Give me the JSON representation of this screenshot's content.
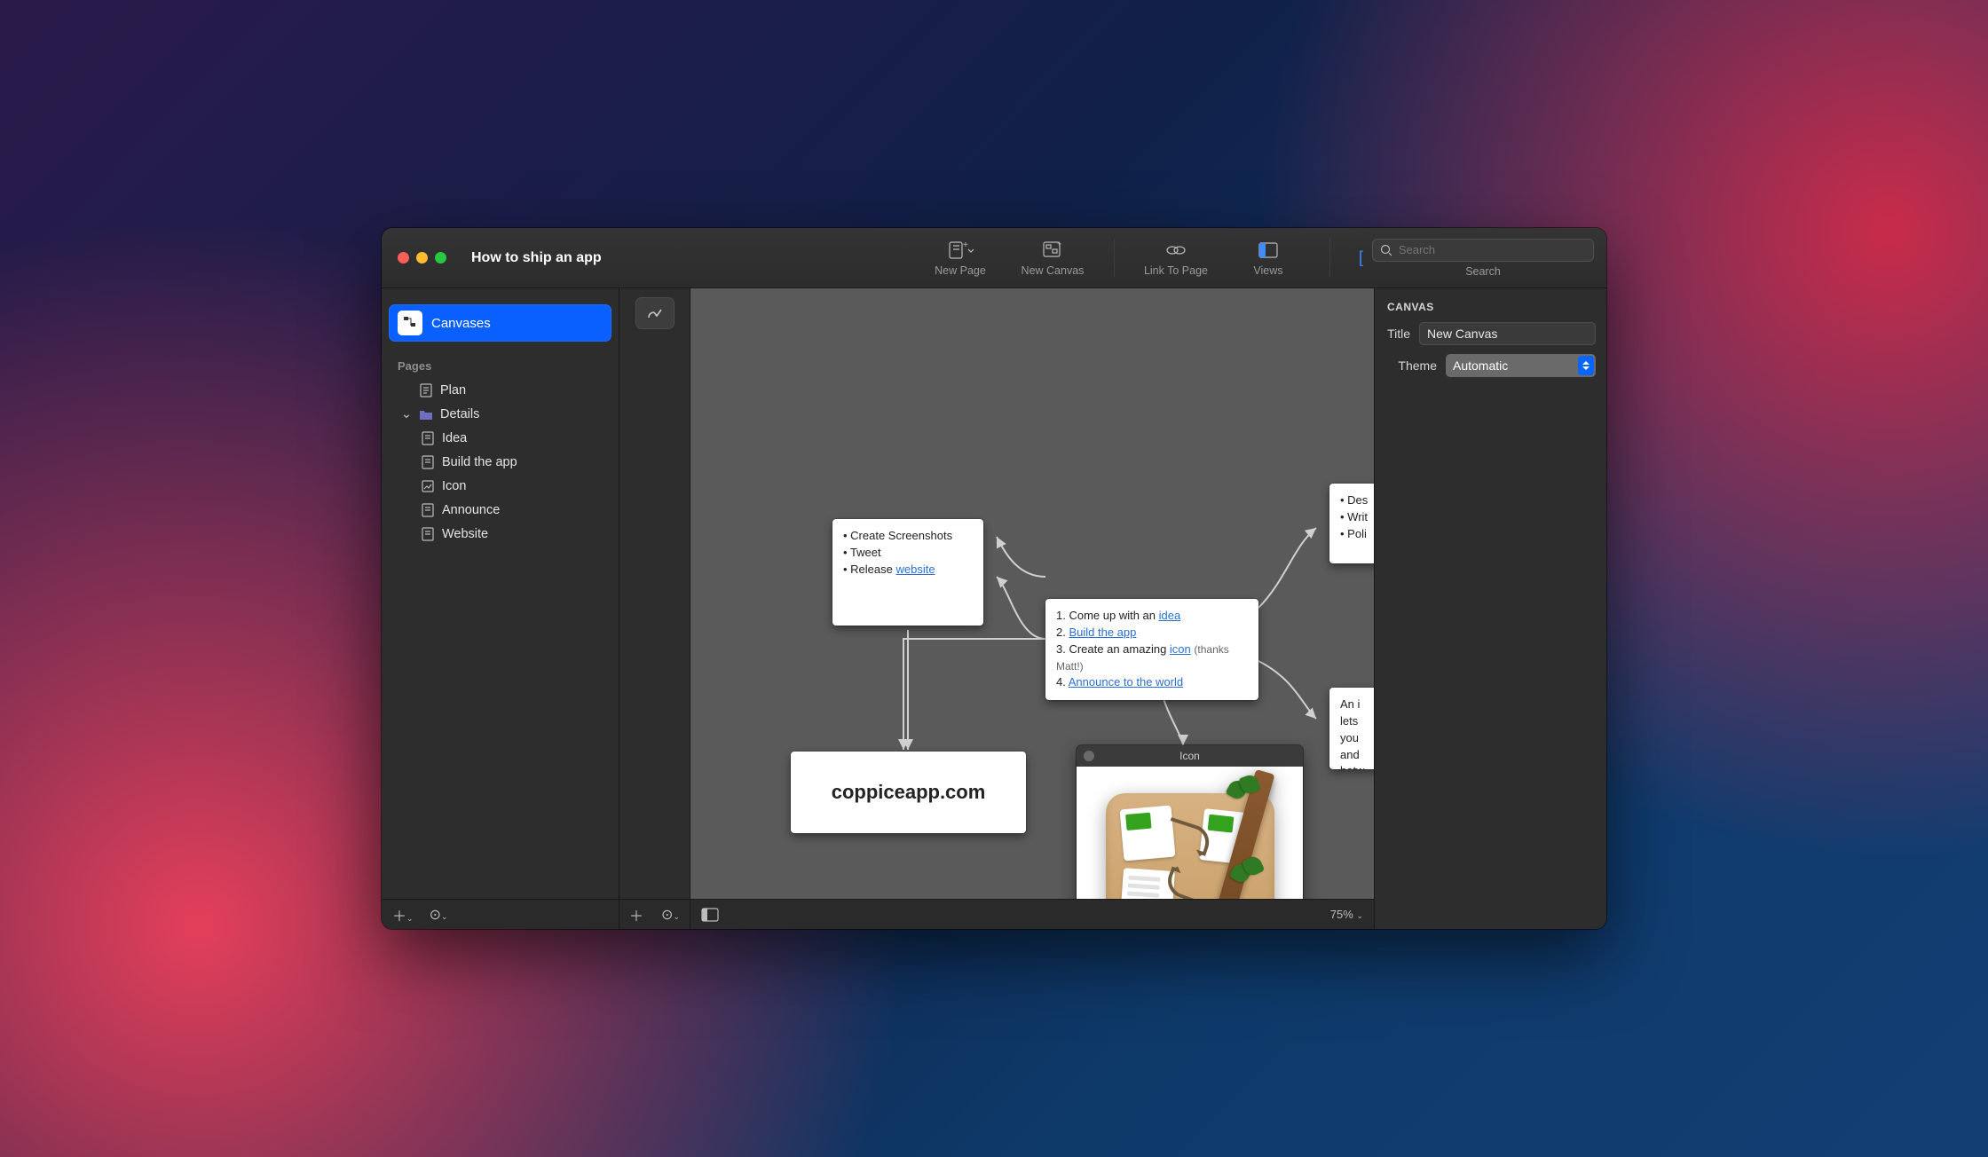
{
  "window_title": "How to ship an app",
  "toolbar": {
    "new_page": "New Page",
    "new_canvas": "New Canvas",
    "link_to_page": "Link To Page",
    "views": "Views",
    "search_label": "Search",
    "search_placeholder": "Search"
  },
  "sidebar": {
    "tab_label": "Canvases",
    "section_label": "Pages",
    "items": [
      {
        "label": "Plan",
        "icon": "page",
        "depth": 0,
        "expandable": false
      },
      {
        "label": "Details",
        "icon": "folder",
        "depth": 0,
        "expandable": true,
        "expanded": true
      },
      {
        "label": "Idea",
        "icon": "page",
        "depth": 1
      },
      {
        "label": "Build the app",
        "icon": "page",
        "depth": 1
      },
      {
        "label": "Icon",
        "icon": "image",
        "depth": 1
      },
      {
        "label": "Announce",
        "icon": "page",
        "depth": 1
      },
      {
        "label": "Website",
        "icon": "page",
        "depth": 1
      }
    ]
  },
  "inspector": {
    "section": "CANVAS",
    "title_label": "Title",
    "title_value": "New Canvas",
    "theme_label": "Theme",
    "theme_value": "Automatic"
  },
  "canvas": {
    "zoom": "75%",
    "icon_window_title": "Icon",
    "cards": {
      "announce": {
        "b1": "Create Screenshots",
        "b2": "Tweet",
        "b3_prefix": "Release ",
        "b3_link": "website"
      },
      "steps": {
        "s1_prefix": "Come up with an ",
        "s1_link": "idea",
        "s2_link": "Build the app",
        "s3_prefix": "Create an amazing ",
        "s3_link": "icon",
        "s3_paren": "(thanks Matt!)",
        "s4_link": "Announce to the world"
      },
      "website_big": "coppiceapp.com",
      "side_top": {
        "l1": "Des",
        "l2": "Writ",
        "l3": "Poli"
      },
      "side_bottom": {
        "l1": "An i",
        "l2": "lets",
        "l3": "you",
        "l4": "and",
        "l5": "betw"
      }
    }
  }
}
